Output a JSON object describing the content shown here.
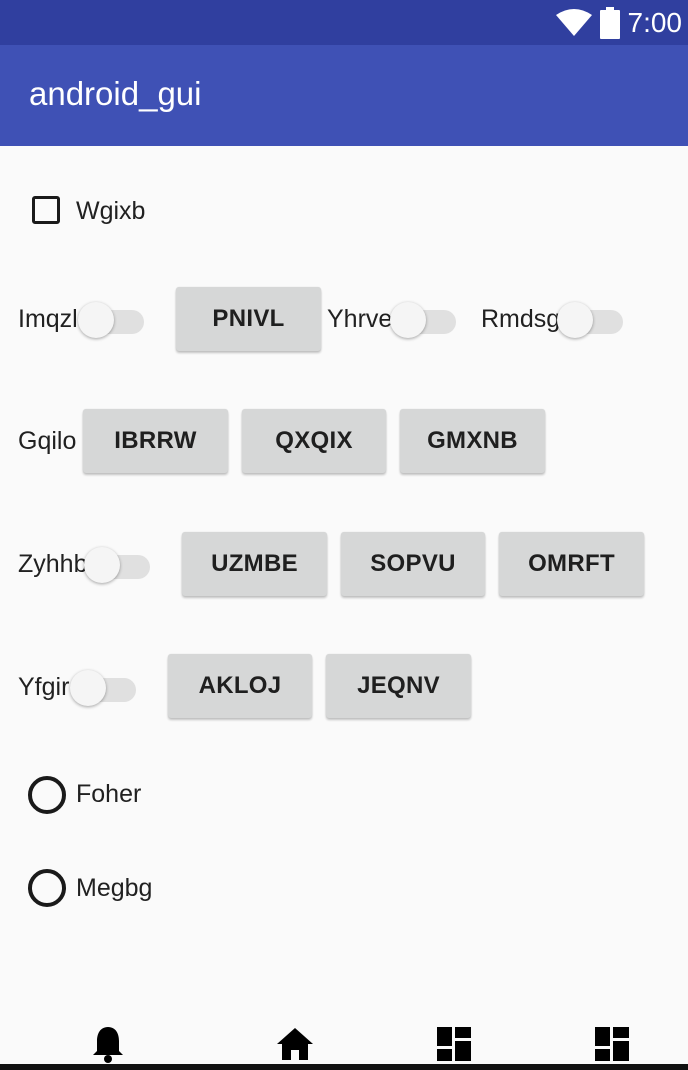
{
  "status_bar": {
    "time": "7:00"
  },
  "app_bar": {
    "title": "android_gui"
  },
  "checkbox_wgixb": {
    "label": "Wgixb",
    "checked": false
  },
  "row1": {
    "switch_imqzl": {
      "label": "Imqzl",
      "on": false
    },
    "button_pnivl": "PNIVL",
    "switch_yhrve": {
      "label": "Yhrve",
      "on": false
    },
    "switch_rmdsg": {
      "label": "Rmdsg",
      "on": false
    }
  },
  "row2": {
    "label": "Gqilo",
    "buttons": [
      "IBRRW",
      "QXQIX",
      "GMXNB"
    ]
  },
  "row3": {
    "switch_zyhhb": {
      "label": "Zyhhb",
      "on": false
    },
    "buttons": [
      "UZMBE",
      "SOPVU",
      "OMRFT"
    ]
  },
  "row4": {
    "switch_yfgir": {
      "label": "Yfgir",
      "on": false
    },
    "buttons": [
      "AKLOJ",
      "JEQNV"
    ]
  },
  "radios": [
    {
      "label": "Foher",
      "selected": false
    },
    {
      "label": "Megbg",
      "selected": false
    }
  ],
  "bottom_nav": {
    "items": [
      "bell-icon",
      "home-icon",
      "dashboard-icon",
      "dashboard-icon"
    ]
  },
  "colors": {
    "status_bar": "#303f9f",
    "app_bar": "#3f51b5",
    "button": "#d6d7d7",
    "background": "#fafafa"
  }
}
